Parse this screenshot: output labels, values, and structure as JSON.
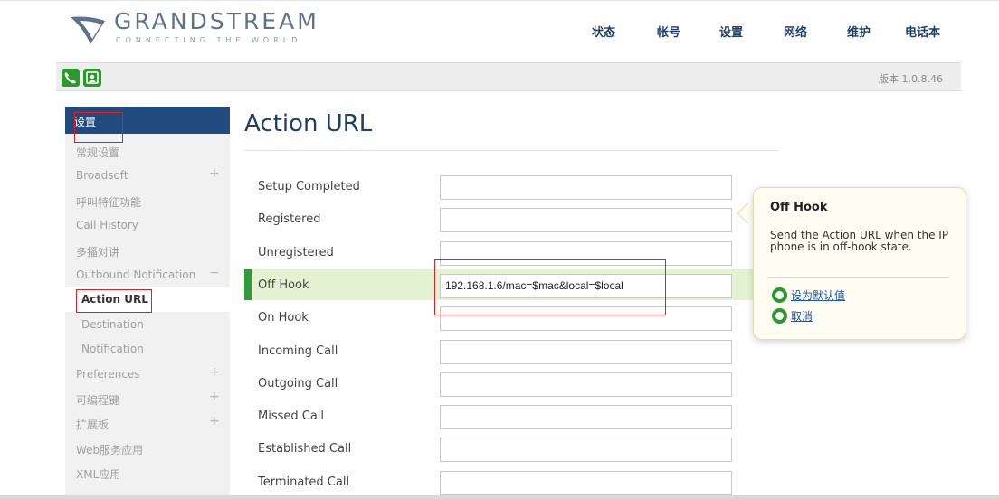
{
  "header": {
    "logo_text": "GRANDSTREAM",
    "logo_tagline": "CONNECTING THE WORLD",
    "nav": [
      {
        "label": "状态",
        "name": "nav-status"
      },
      {
        "label": "帐号",
        "name": "nav-account"
      },
      {
        "label": "设置",
        "name": "nav-settings"
      },
      {
        "label": "网络",
        "name": "nav-network"
      },
      {
        "label": "维护",
        "name": "nav-maintenance"
      },
      {
        "label": "电话本",
        "name": "nav-phonebook"
      }
    ]
  },
  "subbar": {
    "version": "版本 1.0.8.46",
    "icons": [
      "phone-icon",
      "contacts-icon"
    ]
  },
  "sidebar": {
    "header": "设置",
    "items": [
      {
        "label": "常规设置",
        "indent": 0,
        "expander": ""
      },
      {
        "label": "Broadsoft",
        "indent": 0,
        "expander": "+"
      },
      {
        "label": "呼叫特征功能",
        "indent": 0,
        "expander": ""
      },
      {
        "label": "Call History",
        "indent": 0,
        "expander": ""
      },
      {
        "label": "多播对讲",
        "indent": 0,
        "expander": ""
      },
      {
        "label": "Outbound Notification",
        "indent": 0,
        "expander": "−"
      },
      {
        "label": "Action URL",
        "indent": 1,
        "expander": "",
        "active": true
      },
      {
        "label": "Destination",
        "indent": 1,
        "expander": ""
      },
      {
        "label": "Notification",
        "indent": 1,
        "expander": ""
      },
      {
        "label": "Preferences",
        "indent": 0,
        "expander": "+"
      },
      {
        "label": "可编程键",
        "indent": 0,
        "expander": "+"
      },
      {
        "label": "扩展板",
        "indent": 0,
        "expander": "+"
      },
      {
        "label": "Web服务应用",
        "indent": 0,
        "expander": ""
      },
      {
        "label": "XML应用",
        "indent": 0,
        "expander": ""
      }
    ]
  },
  "main": {
    "title": "Action URL",
    "rows": [
      {
        "label": "Setup Completed",
        "value": ""
      },
      {
        "label": "Registered",
        "value": ""
      },
      {
        "label": "Unregistered",
        "value": ""
      },
      {
        "label": "Off Hook",
        "value": "192.168.1.6/mac=$mac&local=$local",
        "highlight": true
      },
      {
        "label": "On Hook",
        "value": ""
      },
      {
        "label": "Incoming Call",
        "value": ""
      },
      {
        "label": "Outgoing Call",
        "value": ""
      },
      {
        "label": "Missed Call",
        "value": ""
      },
      {
        "label": "Established Call",
        "value": ""
      },
      {
        "label": "Terminated Call",
        "value": ""
      }
    ]
  },
  "tooltip": {
    "title": "Off Hook",
    "description": "Send the Action URL when the IP phone is in off-hook state.",
    "set_default_label": "设为默认值",
    "cancel_label": "取消"
  },
  "colors": {
    "accent": "#214b7e",
    "highlight_row": "#e3f3d2",
    "highlight_bar": "#2f9c3c",
    "annotation_red": "#e02020"
  }
}
